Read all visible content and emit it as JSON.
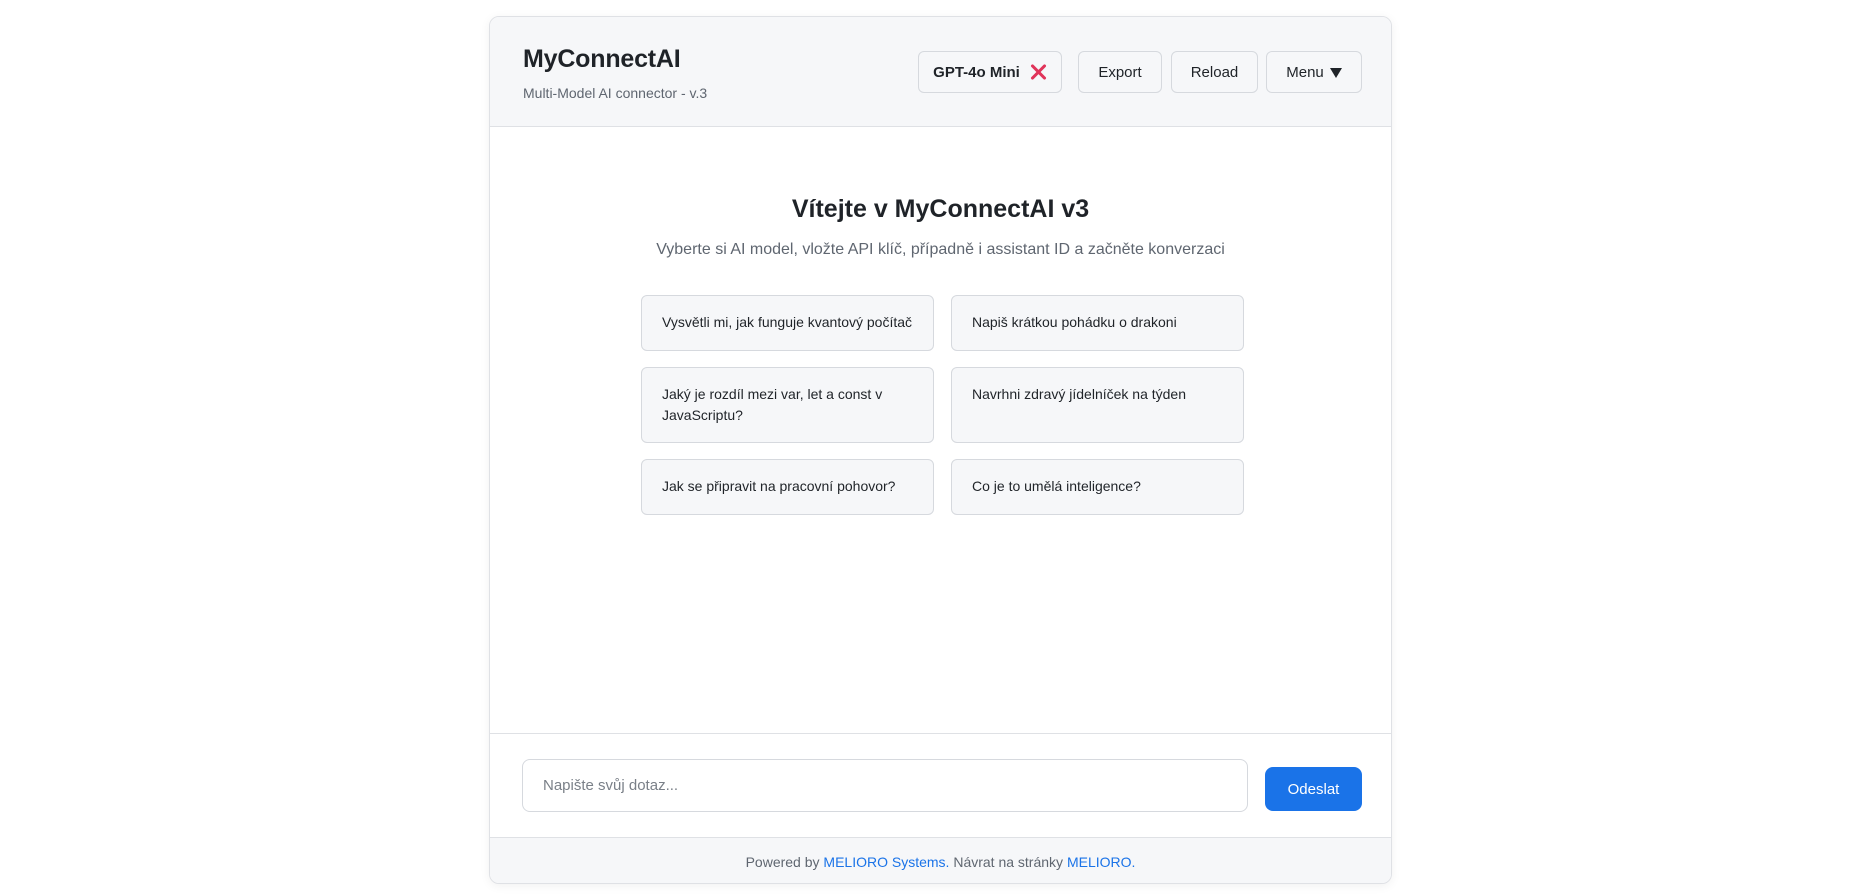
{
  "header": {
    "title": "MyConnectAI",
    "subtitle": "Multi-Model AI connector - v.3",
    "model_badge": "GPT-4o Mini",
    "model_badge_icon": "close-icon",
    "export_label": "Export",
    "reload_label": "Reload",
    "menu_label": "Menu",
    "menu_icon": "caret-down-icon"
  },
  "main": {
    "title": "Vítejte v MyConnectAI v3",
    "subtitle": "Vyberte si AI model, vložte API klíč, případně i assistant ID a začněte konverzaci",
    "suggestions": [
      "Vysvětli mi, jak funguje kvantový počítač",
      "Napiš krátkou pohádku o drakoni",
      "Jaký je rozdíl mezi var, let a const v JavaScriptu?",
      "Navrhni zdravý jídelníček na týden",
      "Jak se připravit na pracovní pohovor?",
      "Co je to umělá inteligence?"
    ]
  },
  "input": {
    "placeholder": "Napište svůj dotaz...",
    "value": "",
    "send_label": "Odeslat"
  },
  "footer": {
    "prefix": "Powered by",
    "company_link": "MELIORO Systems.",
    "middle": "Návrat na stránky",
    "site_link": "MELIORO."
  },
  "colors": {
    "accent": "#1a73e8",
    "close_icon": "#e0345a",
    "panel_bg": "#f6f7f9",
    "border": "#dfe1e5"
  }
}
